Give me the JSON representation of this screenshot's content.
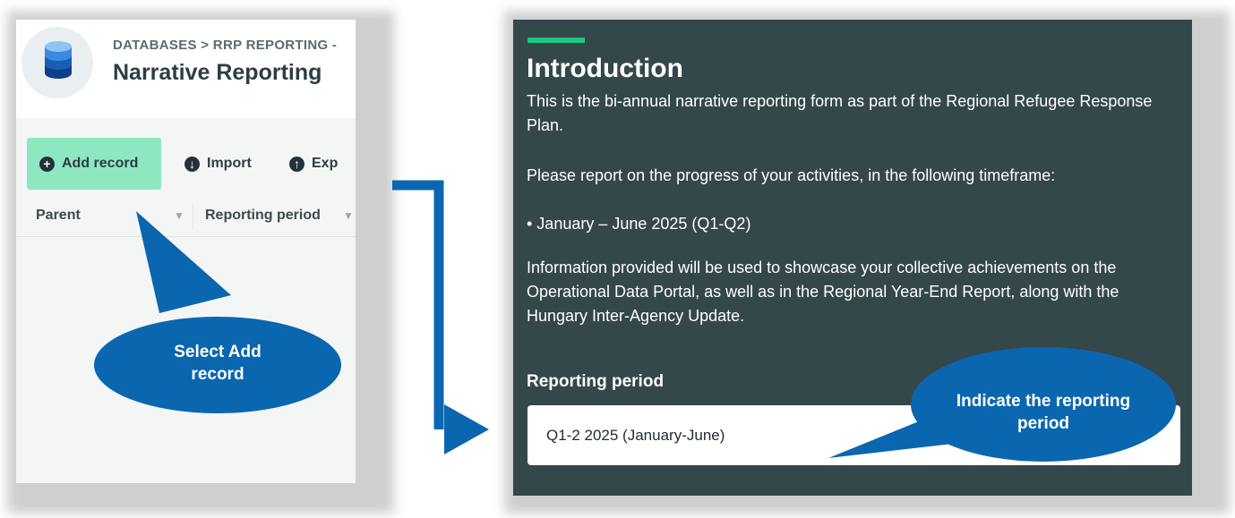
{
  "left_panel": {
    "breadcrumb": "DATABASES > RRP REPORTING -",
    "title": "Narrative Reporting",
    "toolbar": {
      "add_record": "Add record",
      "import": "Import",
      "export": "Exp"
    },
    "columns": [
      "Parent",
      "Reporting period"
    ]
  },
  "callouts": {
    "left": "Select Add record",
    "right": "Indicate the reporting period"
  },
  "right_panel": {
    "title": "Introduction",
    "paragraphs": [
      "This is the bi-annual narrative reporting form as part of the Regional Refugee Response Plan.",
      "Please report on the progress of your activities, in the following timeframe:",
      "• January – June 2025 (Q1-Q2)",
      "Information provided will be used to showcase your collective achievements on the Operational Data Portal, as well as in the Regional Year-End Report, along with the Hungary Inter-Agency Update."
    ],
    "reporting_period_label": "Reporting period",
    "reporting_period_value": "Q1-2 2025 (January-June)"
  },
  "colors": {
    "accent_green": "#1ec87d",
    "add_button": "#8de8c2",
    "callout_blue": "#0b66b0",
    "dark_panel": "#34474b"
  }
}
